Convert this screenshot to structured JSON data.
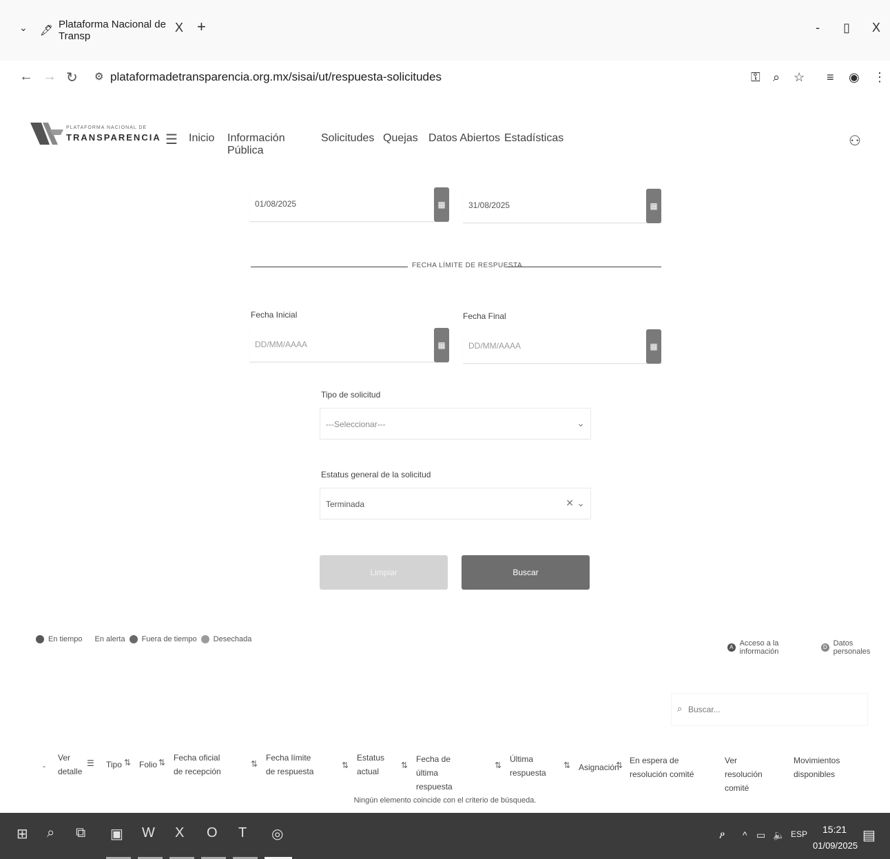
{
  "browser": {
    "tab_title": "Plataforma Nacional de Transp",
    "tab_close": "X",
    "new_tab": "+",
    "url": "plataformadetransparencia.org.mx/sisai/ut/respuesta-solicitudes",
    "window_controls": [
      "-",
      "▯",
      "X"
    ]
  },
  "site": {
    "logo_small": "PLATAFORMA NACIONAL DE",
    "logo_big": "TRANSPARENCIA",
    "nav": [
      "Inicio",
      "Información Pública",
      "Solicitudes",
      "Quejas",
      "Datos Abiertos",
      "Estadísticas"
    ]
  },
  "form": {
    "top_dates": {
      "start": "01/08/2025",
      "end": "31/08/2025"
    },
    "section_title": "FECHA LÍMITE DE RESPUESTA",
    "fecha_inicial_label": "Fecha Inicial",
    "fecha_final_label": "Fecha Final",
    "date_placeholder": "DD/MM/AAAA",
    "tipo_label": "Tipo de solicitud",
    "tipo_value": "---Seleccionar---",
    "estatus_label": "Estatus general de la solicitud",
    "estatus_value": "Terminada",
    "clear_button": "Limpiar",
    "search_button": "Buscar"
  },
  "legend_left": [
    "En tiempo",
    "En alerta",
    "Fuera de tiempo",
    "Desechada"
  ],
  "legend_right": [
    "Acceso a la información",
    "Datos personales"
  ],
  "search": {
    "placeholder": "Buscar..."
  },
  "table": {
    "columns": {
      "ver": "Ver detalle",
      "tipo": "Tipo",
      "folio": "Folio",
      "fecha_oficial": "Fecha oficial de recepción",
      "fecha_limite": "Fecha límite de respuesta",
      "estatus": "Estatus actual",
      "fecha_ultima": "Fecha de última respuesta",
      "ultima": "Última respuesta",
      "asignacion": "Asignación",
      "espera": "En espera de resolución comité",
      "ver_resolucion": "Ver resolución comité",
      "movimientos": "Movimientos disponibles"
    },
    "empty_message": "Ningún elemento coincide con el criterio de búsqueda."
  },
  "taskbar": {
    "time": "15:21",
    "date": "01/09/2025",
    "lang": "ESP"
  },
  "colors": {
    "legend_en_tiempo": "#5a5a5a",
    "legend_en_alerta": "#ffffff",
    "legend_fuera": "#6a6a6a",
    "legend_desechada": "#9a9a9a",
    "button_dark": "#6f6f6f"
  }
}
